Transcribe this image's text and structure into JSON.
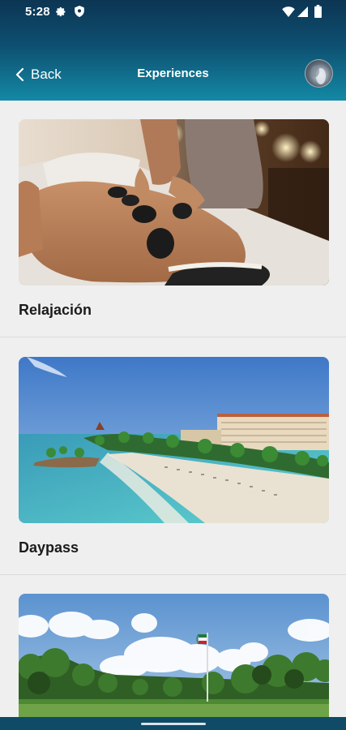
{
  "status_bar": {
    "time": "5:28",
    "icons": [
      "gear-icon",
      "shield-icon",
      "wifi-icon",
      "signal-icon",
      "battery-icon"
    ]
  },
  "app_bar": {
    "back_label": "Back",
    "title": "Experiences",
    "avatar_icon": "user-avatar"
  },
  "experiences": [
    {
      "title": "Relajación",
      "image": "hot-stone-massage-photo"
    },
    {
      "title": "Daypass",
      "image": "beach-resort-photo"
    },
    {
      "title": "",
      "image": "golf-course-photo"
    }
  ],
  "colors": {
    "header_top": "#0c3553",
    "header_bottom": "#1389a5",
    "background": "#efefef",
    "title_text": "#1b1b1b"
  }
}
